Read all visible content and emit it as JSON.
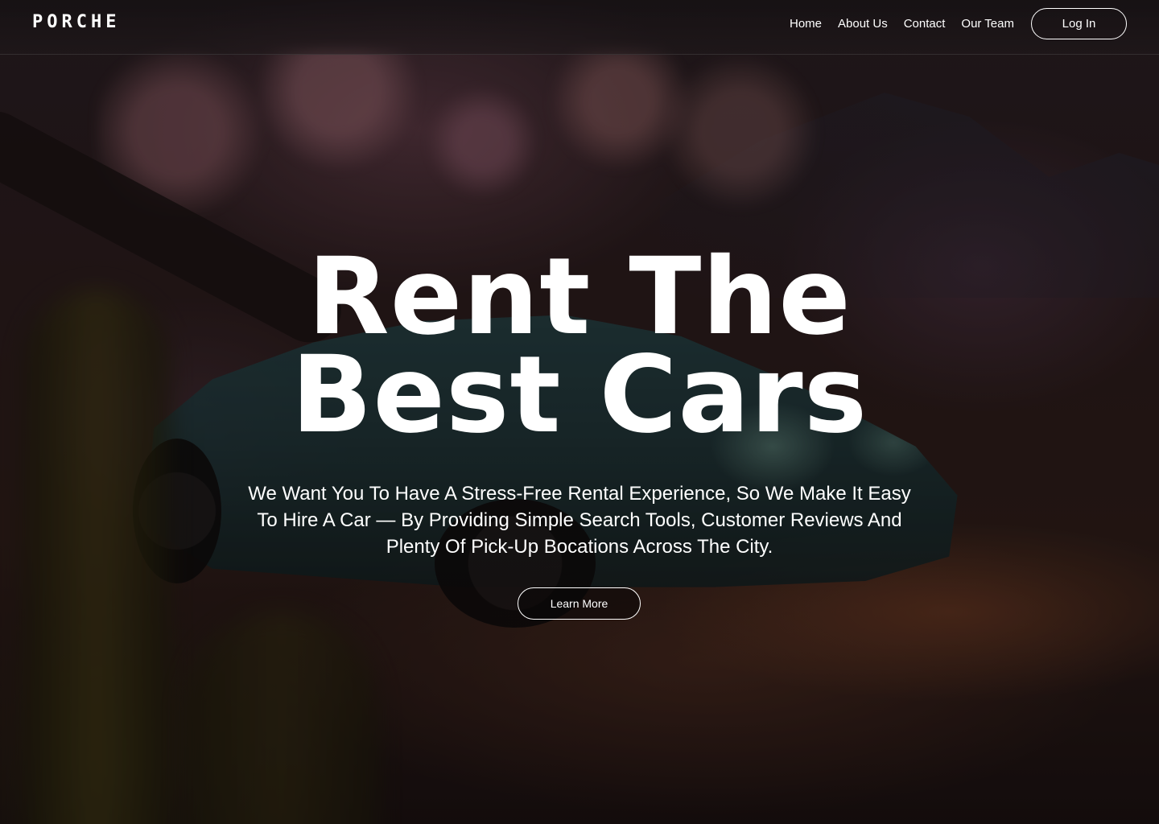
{
  "header": {
    "logo": "PORCHE",
    "nav": [
      {
        "label": "Home"
      },
      {
        "label": "About Us"
      },
      {
        "label": "Contact"
      },
      {
        "label": "Our Team"
      }
    ],
    "login_label": "Log In"
  },
  "hero": {
    "title_line1": "Rent The",
    "title_line2": "Best Cars",
    "subtitle": "We Want You To Have A Stress-Free  Rental Experience, So We Make It Easy To Hire A Car — By Providing  Simple Search Tools, Customer  Reviews And Plenty Of Pick-Up  Bocations Across The City.",
    "cta_label": "Learn More"
  },
  "colors": {
    "text": "#ffffff",
    "button_border": "#ffffff"
  }
}
